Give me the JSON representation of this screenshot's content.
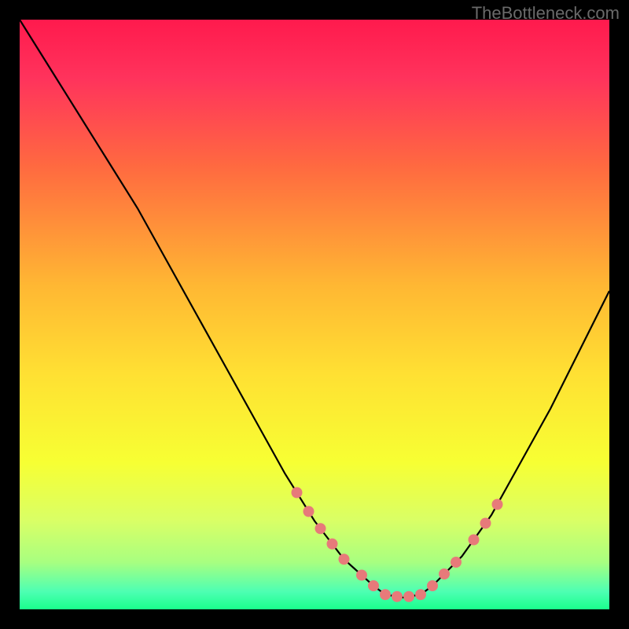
{
  "watermark": "TheBottleneck.com",
  "chart_data": {
    "type": "line",
    "title": "",
    "xlabel": "",
    "ylabel": "",
    "xlim": [
      0,
      100
    ],
    "ylim": [
      0,
      100
    ],
    "curve": {
      "x": [
        0,
        5,
        10,
        15,
        20,
        25,
        30,
        35,
        40,
        45,
        50,
        55,
        60,
        62,
        65,
        68,
        70,
        75,
        80,
        85,
        90,
        95,
        100
      ],
      "y": [
        100,
        92,
        84,
        76,
        68,
        59,
        50,
        41,
        32,
        23,
        15,
        8.5,
        4,
        2.5,
        2,
        2.5,
        4,
        9,
        16,
        25,
        34,
        44,
        54
      ]
    },
    "points_on_curve_x": [
      47,
      49,
      51,
      53,
      55,
      58,
      60,
      62,
      64,
      66,
      68,
      70,
      72,
      74,
      77,
      79,
      81
    ],
    "point_color": "#e77a7a",
    "gradient_stops": [
      {
        "offset": 0.0,
        "color": "#ff1a4d"
      },
      {
        "offset": 0.1,
        "color": "#ff335c"
      },
      {
        "offset": 0.25,
        "color": "#ff6a40"
      },
      {
        "offset": 0.45,
        "color": "#ffb733"
      },
      {
        "offset": 0.6,
        "color": "#ffe033"
      },
      {
        "offset": 0.75,
        "color": "#f7ff33"
      },
      {
        "offset": 0.85,
        "color": "#d9ff66"
      },
      {
        "offset": 0.92,
        "color": "#a8ff80"
      },
      {
        "offset": 0.97,
        "color": "#4dffb3"
      },
      {
        "offset": 1.0,
        "color": "#1aff8c"
      }
    ]
  }
}
